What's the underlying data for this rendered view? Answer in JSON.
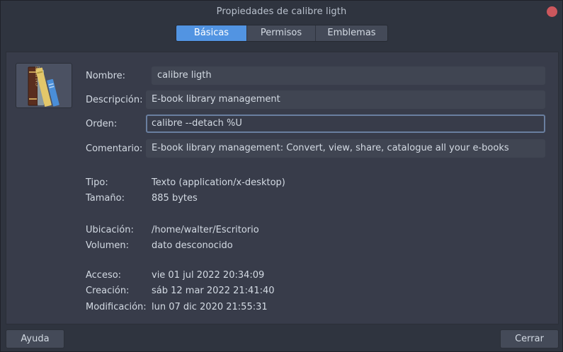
{
  "window": {
    "title": "Propiedades de calibre ligth"
  },
  "tabs": [
    {
      "label": "Básicas",
      "active": true
    },
    {
      "label": "Permisos",
      "active": false
    },
    {
      "label": "Emblemas",
      "active": false
    }
  ],
  "icon": {
    "name": "calibre-books-icon",
    "text": "CALIBRE"
  },
  "fields": {
    "name": {
      "label": "Nombre:",
      "value": "calibre ligth"
    },
    "description": {
      "label": "Descripción:",
      "value": "E-book library management"
    },
    "command": {
      "label": "Orden:",
      "value": "calibre --detach %U"
    },
    "comment": {
      "label": "Comentario:",
      "value": "E-book library management: Convert, view, share, catalogue all your e-books"
    }
  },
  "info": {
    "type": {
      "label": "Tipo:",
      "value": "Texto (application/x-desktop)"
    },
    "size": {
      "label": "Tamaño:",
      "value": "885 bytes"
    },
    "location": {
      "label": "Ubicación:",
      "value": "/home/walter/Escritorio"
    },
    "volume": {
      "label": "Volumen:",
      "value": "dato desconocido"
    },
    "accessed": {
      "label": "Acceso:",
      "value": "vie 01 jul 2022 20:34:09"
    },
    "created": {
      "label": "Creación:",
      "value": "sáb 12 mar 2022 21:41:40"
    },
    "modified": {
      "label": "Modificación:",
      "value": "lun 07 dic 2020 21:55:31"
    }
  },
  "buttons": {
    "help": "Ayuda",
    "close": "Cerrar"
  },
  "colors": {
    "accent": "#5294e2",
    "close": "#cc575d",
    "background": "#383c4a"
  }
}
